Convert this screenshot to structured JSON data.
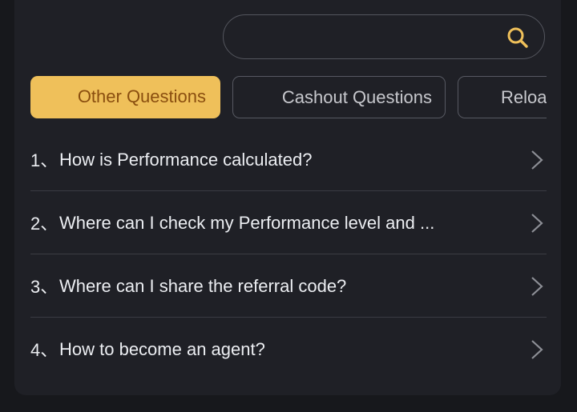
{
  "search": {
    "value": "",
    "placeholder": ""
  },
  "tabs": [
    {
      "label": "Other Questions",
      "active": true
    },
    {
      "label": "Cashout Questions",
      "active": false
    },
    {
      "label": "Reloa",
      "active": false
    }
  ],
  "faq": [
    {
      "number": "1、",
      "question": "How is Performance calculated?"
    },
    {
      "number": "2、",
      "question": "Where can I check my Performance level and ..."
    },
    {
      "number": "3、",
      "question": "Where can I share the referral code?"
    },
    {
      "number": "4、",
      "question": "How to become an agent?"
    }
  ],
  "icons": {
    "search": "search-icon",
    "chevron": "chevron-right-icon"
  },
  "colors": {
    "background": "#17181c",
    "panel": "#1f2026",
    "accent": "#efc05a",
    "accent_text": "#8a4e0f",
    "text": "#eceef2",
    "muted_text": "#c7c8cd",
    "border": "#575962"
  }
}
